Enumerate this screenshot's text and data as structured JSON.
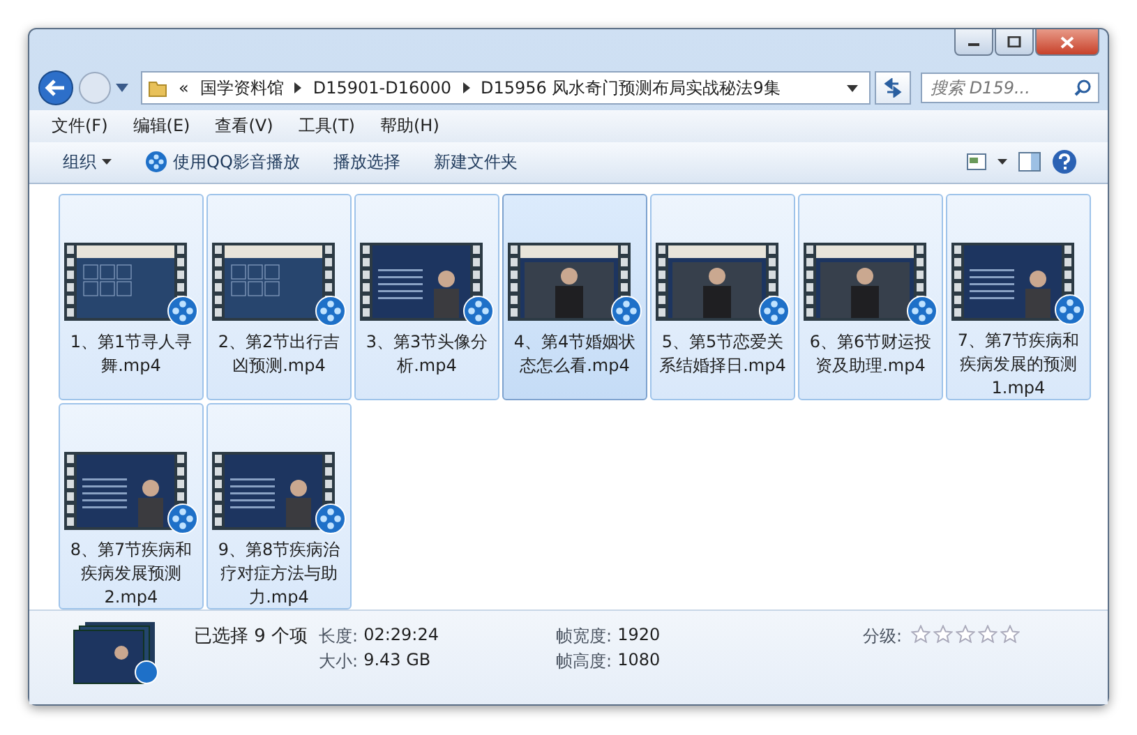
{
  "address": {
    "crumbs": [
      "«",
      "国学资料馆",
      "D15901-D16000",
      "D15956 风水奇门预测布局实战秘法9集"
    ],
    "search_placeholder": "搜索 D159..."
  },
  "menu": [
    "文件(F)",
    "编辑(E)",
    "查看(V)",
    "工具(T)",
    "帮助(H)"
  ],
  "toolbar": [
    {
      "label": "组织",
      "kind": "dropdown"
    },
    {
      "label": "使用QQ影音播放",
      "kind": "player"
    },
    {
      "label": "播放选择",
      "kind": "plain"
    },
    {
      "label": "新建文件夹",
      "kind": "plain"
    }
  ],
  "files": [
    {
      "name": "1、第1节寻人寻舞.mp4",
      "selected": true,
      "hovered": false,
      "kind": "board"
    },
    {
      "name": "2、第2节出行吉凶预测.mp4",
      "selected": true,
      "hovered": false,
      "kind": "board"
    },
    {
      "name": "3、第3节头像分析.mp4",
      "selected": true,
      "hovered": false,
      "kind": "slide"
    },
    {
      "name": "4、第4节婚姻状态怎么看.mp4",
      "selected": true,
      "hovered": true,
      "kind": "speaker"
    },
    {
      "name": "5、第5节恋爱关系结婚择日.mp4",
      "selected": true,
      "hovered": false,
      "kind": "speaker"
    },
    {
      "name": "6、第6节财运投资及助理.mp4",
      "selected": true,
      "hovered": false,
      "kind": "speaker"
    },
    {
      "name": "7、第7节疾病和疾病发展的预测1.mp4",
      "selected": true,
      "hovered": false,
      "kind": "slide"
    },
    {
      "name": "8、第7节疾病和疾病发展预测2.mp4",
      "selected": true,
      "hovered": false,
      "kind": "slide"
    },
    {
      "name": "9、第8节疾病治疗对症方法与助力.mp4",
      "selected": true,
      "hovered": false,
      "kind": "slide"
    }
  ],
  "details": {
    "summary": "已选择 9 个项",
    "fields": [
      {
        "label": "长度:",
        "value": "02:29:24"
      },
      {
        "label": "大小:",
        "value": "9.43 GB"
      },
      {
        "label": "帧宽度:",
        "value": "1920"
      },
      {
        "label": "帧高度:",
        "value": "1080"
      }
    ],
    "rating_label": "分级:",
    "stars": 0
  }
}
